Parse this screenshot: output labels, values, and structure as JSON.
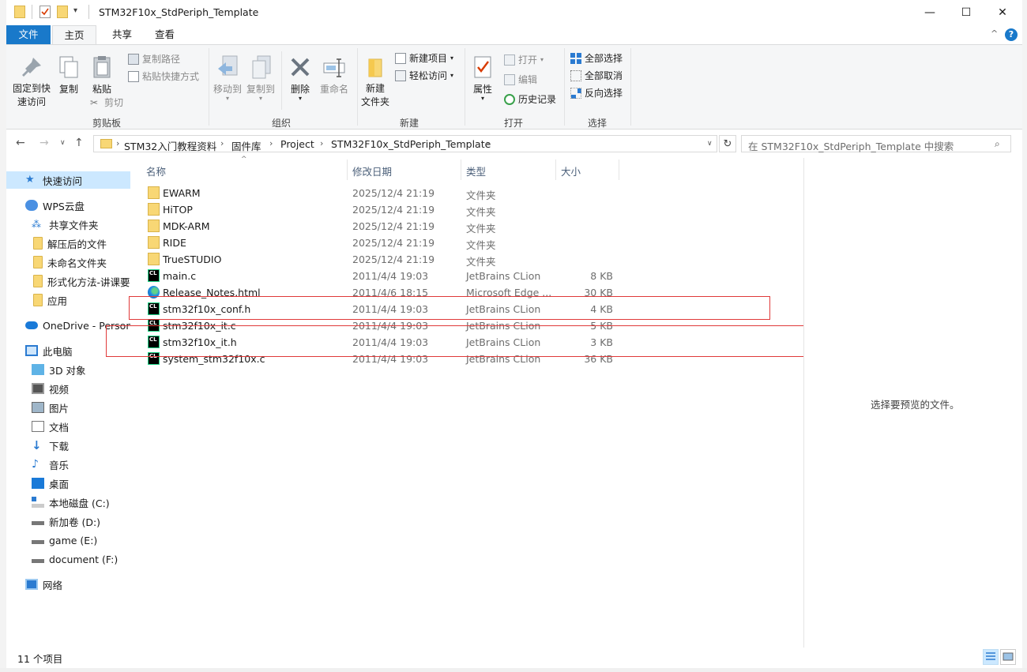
{
  "window": {
    "title": "STM32F10x_StdPeriph_Template",
    "controls": {
      "minimize": "—",
      "maximize": "☐",
      "close": "✕"
    }
  },
  "ribbon_tabs": [
    "文件",
    "主页",
    "共享",
    "查看"
  ],
  "ribbon": {
    "clipboard": {
      "pin": "固定到快\n速访问",
      "copy": "复制",
      "paste": "粘贴",
      "copy_path": "复制路径",
      "paste_shortcut": "粘贴快捷方式",
      "cut": "剪切",
      "label": "剪贴板"
    },
    "organize": {
      "move_to": "移动到",
      "copy_to": "复制到",
      "delete": "删除",
      "rename": "重命名",
      "label": "组织"
    },
    "new": {
      "new_folder": "新建\n文件夹",
      "new_item": "新建项目",
      "easy_access": "轻松访问",
      "label": "新建"
    },
    "open": {
      "properties": "属性",
      "open": "打开",
      "edit": "编辑",
      "history": "历史记录",
      "label": "打开"
    },
    "select": {
      "select_all": "全部选择",
      "select_none": "全部取消",
      "invert": "反向选择",
      "label": "选择"
    }
  },
  "address": {
    "breadcrumbs": [
      "STM32入门教程资料",
      "固件库",
      "Project",
      "STM32F10x_StdPeriph_Template"
    ],
    "search_placeholder": "在 STM32F10x_StdPeriph_Template 中搜索"
  },
  "navpane": {
    "items": [
      {
        "label": "快速访问",
        "icon": "star-icon"
      },
      {
        "label": "WPS云盘",
        "icon": "cloud-icon"
      },
      {
        "label": "共享文件夹",
        "icon": "share-icon"
      },
      {
        "label": "解压后的文件",
        "icon": "folder-icon"
      },
      {
        "label": "未命名文件夹",
        "icon": "folder-icon"
      },
      {
        "label": "形式化方法-讲课要",
        "icon": "folder-icon"
      },
      {
        "label": "应用",
        "icon": "folder-icon"
      },
      {
        "label": "OneDrive - Persona",
        "icon": "onedrive-icon"
      },
      {
        "label": "此电脑",
        "icon": "pc-icon"
      },
      {
        "label": "3D 对象",
        "icon": "3d-icon"
      },
      {
        "label": "视频",
        "icon": "video-icon"
      },
      {
        "label": "图片",
        "icon": "picture-icon"
      },
      {
        "label": "文档",
        "icon": "document-icon"
      },
      {
        "label": "下载",
        "icon": "download-icon"
      },
      {
        "label": "音乐",
        "icon": "music-icon"
      },
      {
        "label": "桌面",
        "icon": "desktop-icon"
      },
      {
        "label": "本地磁盘 (C:)",
        "icon": "drive-icon"
      },
      {
        "label": "新加卷 (D:)",
        "icon": "drive-icon"
      },
      {
        "label": "game (E:)",
        "icon": "drive-icon"
      },
      {
        "label": "document (F:)",
        "icon": "drive-icon"
      },
      {
        "label": "网络",
        "icon": "network-icon"
      }
    ]
  },
  "filelist": {
    "columns": [
      "名称",
      "修改日期",
      "类型",
      "大小"
    ],
    "rows": [
      {
        "name": "EWARM",
        "date": "2025/12/4 21:19",
        "type": "文件夹",
        "size": "",
        "icon": "folder-icon"
      },
      {
        "name": "HiTOP",
        "date": "2025/12/4 21:19",
        "type": "文件夹",
        "size": "",
        "icon": "folder-icon"
      },
      {
        "name": "MDK-ARM",
        "date": "2025/12/4 21:19",
        "type": "文件夹",
        "size": "",
        "icon": "folder-icon"
      },
      {
        "name": "RIDE",
        "date": "2025/12/4 21:19",
        "type": "文件夹",
        "size": "",
        "icon": "folder-icon"
      },
      {
        "name": "TrueSTUDIO",
        "date": "2025/12/4 21:19",
        "type": "文件夹",
        "size": "",
        "icon": "folder-icon"
      },
      {
        "name": "main.c",
        "date": "2011/4/4 19:03",
        "type": "JetBrains CLion",
        "size": "8 KB",
        "icon": "clion-icon"
      },
      {
        "name": "Release_Notes.html",
        "date": "2011/4/6 18:15",
        "type": "Microsoft Edge ...",
        "size": "30 KB",
        "icon": "edge-icon"
      },
      {
        "name": "stm32f10x_conf.h",
        "date": "2011/4/4 19:03",
        "type": "JetBrains CLion",
        "size": "4 KB",
        "icon": "clion-icon"
      },
      {
        "name": "stm32f10x_it.c",
        "date": "2011/4/4 19:03",
        "type": "JetBrains CLion",
        "size": "5 KB",
        "icon": "clion-icon"
      },
      {
        "name": "stm32f10x_it.h",
        "date": "2011/4/4 19:03",
        "type": "JetBrains CLion",
        "size": "3 KB",
        "icon": "clion-icon"
      },
      {
        "name": "system_stm32f10x.c",
        "date": "2011/4/4 19:03",
        "type": "JetBrains CLion",
        "size": "36 KB",
        "icon": "clion-icon"
      }
    ]
  },
  "preview": {
    "text": "选择要预览的文件。"
  },
  "statusbar": {
    "count": "11 个项目"
  },
  "colors": {
    "accent": "#1979ca",
    "selection": "#cce8ff",
    "highlight_box": "#e03a3a"
  }
}
